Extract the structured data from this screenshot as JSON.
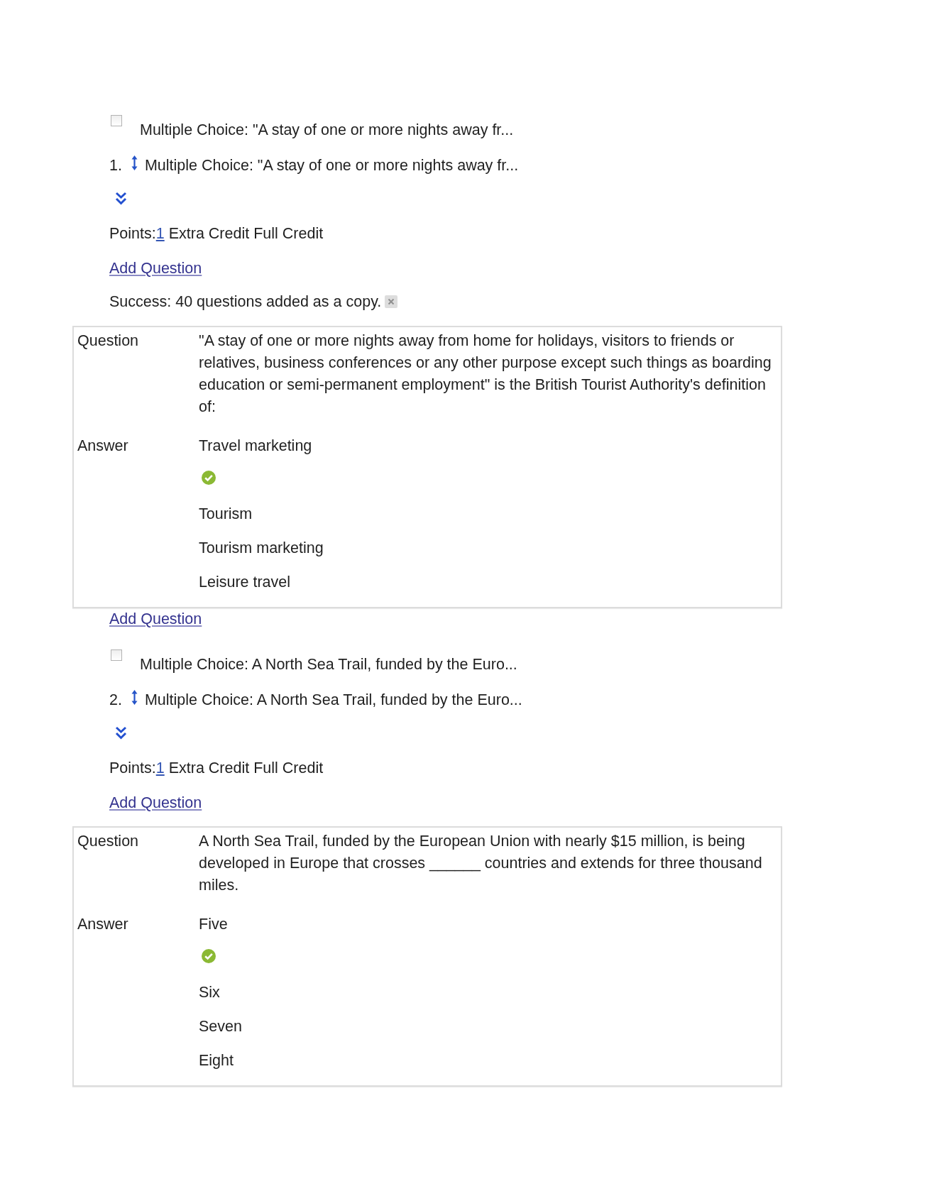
{
  "blocks": [
    {
      "kind": "select_row",
      "checked": false,
      "text": "Multiple Choice: \"A stay of one or more nights away fr..."
    },
    {
      "kind": "title_row",
      "number": "1.",
      "text": "Multiple Choice: \"A stay of one or more nights away fr..."
    },
    {
      "kind": "expand"
    },
    {
      "kind": "points",
      "label": "Points:",
      "value": "1",
      "tags": [
        "Extra Credit",
        "Full Credit"
      ]
    },
    {
      "kind": "link",
      "text": "Add Question"
    },
    {
      "kind": "message",
      "text": "Success: 40 questions added as a copy."
    },
    {
      "kind": "detail",
      "question_label": "Question",
      "question": "\"A stay of one or more nights away from home for holidays, visitors to friends or relatives, business conferences or any other purpose except such things as boarding education or semi-permanent employment\" is the British Tourist Authority's definition of:",
      "answer_label": "Answer",
      "answers": [
        {
          "text": "Travel marketing",
          "correct": true
        },
        {
          "text": "Tourism",
          "correct": false
        },
        {
          "text": "Tourism marketing",
          "correct": false
        },
        {
          "text": "Leisure travel",
          "correct": false
        }
      ]
    },
    {
      "kind": "link",
      "text": "Add Question"
    },
    {
      "kind": "select_row",
      "checked": false,
      "text": "Multiple Choice: A North Sea Trail, funded by the Euro..."
    },
    {
      "kind": "title_row",
      "number": "2.",
      "text": "Multiple Choice: A North Sea Trail, funded by the Euro..."
    },
    {
      "kind": "expand"
    },
    {
      "kind": "points",
      "label": "Points:",
      "value": "1",
      "tags": [
        "Extra Credit",
        "Full Credit"
      ]
    },
    {
      "kind": "link",
      "text": "Add Question"
    },
    {
      "kind": "detail",
      "question_label": "Question",
      "question": "A North Sea Trail, funded by the European Union with nearly $15 million, is being developed in Europe that crosses ______ countries and extends for three thousand miles.",
      "answer_label": "Answer",
      "answers": [
        {
          "text": "Five",
          "correct": true
        },
        {
          "text": "Six",
          "correct": false
        },
        {
          "text": "Seven",
          "correct": false
        },
        {
          "text": "Eight",
          "correct": false
        }
      ]
    }
  ]
}
